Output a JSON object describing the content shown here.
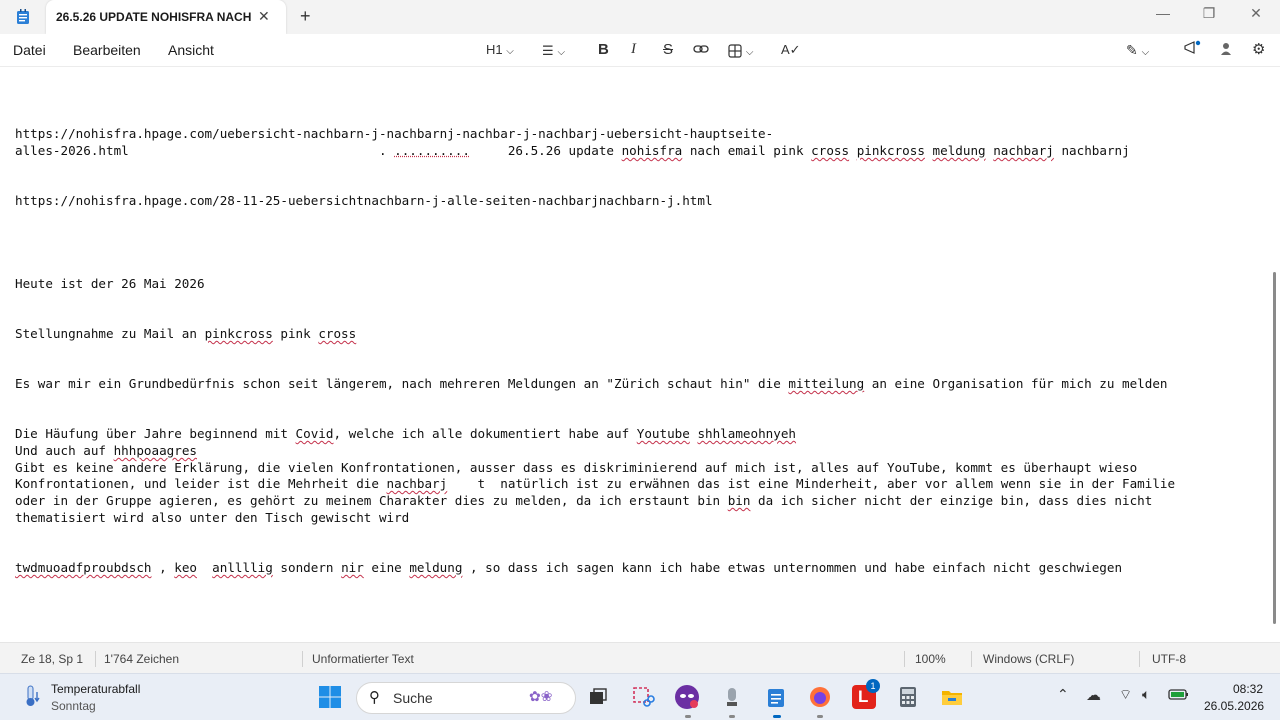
{
  "window": {
    "tab_title": "26.5.26 UPDATE NOHISFRA NACH",
    "tab_close": "✕",
    "new_tab": "+",
    "minimize": "—",
    "maximize": "❐",
    "close": "✕"
  },
  "menu": {
    "datei": "Datei",
    "bearbeiten": "Bearbeiten",
    "ansicht": "Ansicht"
  },
  "toolbar": {
    "heading": "H1",
    "bold": "B",
    "italic": "I",
    "strike": "S"
  },
  "document": {
    "line1": "https://nohisfra.hpage.com/uebersicht-nachbarn-j-nachbarnj-nachbar-j-nachbarj-uebersicht-hauptseite-",
    "line2_a": "alles-2026.html                                 . ",
    "line2_dots": "..........",
    "line2_b": "     26.5.26 update ",
    "line2_w1": "nohisfra",
    "line2_c": " nach email pink ",
    "line2_w2": "cross",
    "line2_d": " ",
    "line2_w3": "pinkcross",
    "line2_e": " ",
    "line2_w4": "meldung",
    "line2_f": " ",
    "line2_w5": "nachbarj",
    "line2_g": " nachbarnj",
    "line3": "https://nohisfra.hpage.com/28-11-25-uebersichtnachbarn-j-alle-seiten-nachbarjnachbarn-j.html",
    "line4": "Heute ist der 26 Mai 2026",
    "line5_a": "Stellungnahme zu Mail an ",
    "line5_w1": "pinkcross",
    "line5_b": " pink ",
    "line5_w2": "cross",
    "line6_a": "Es war mir ein Grundbedürfnis schon seit längerem, nach mehreren Meldungen an \"Zürich schaut hin\" die ",
    "line6_w1": "mitteilung",
    "line6_b": " an eine Organisation für mich zu melden",
    "line7_a": "Die Häufung über Jahre beginnend mit ",
    "line7_w1": "Covid",
    "line7_b": ", welche ich alle dokumentiert habe auf ",
    "line7_w2": "Youtube",
    "line7_c": " ",
    "line7_w3": "shhlameohnyeh",
    "line8_a": "Und auch auf ",
    "line8_w1": "hhhpoaagres",
    "line9": "Gibt es keine andere Erklärung, die vielen Konfrontationen, ausser dass es diskriminierend auf mich ist, alles auf YouTube, kommt es überhaupt wieso",
    "line10_a": "Konfrontationen, und leider ist die Mehrheit die ",
    "line10_w1": "nachbarj",
    "line10_b": "    t  natürlich ist zu erwähnen das ist eine Minderheit, aber vor allem wenn sie in der Familie",
    "line11_a": "oder in der Gruppe agieren, es gehört zu meinem Charakter dies zu melden, da ich erstaunt bin ",
    "line11_w1": "bin",
    "line11_b": " da ich sicher nicht der einzige bin, dass dies nicht",
    "line12": "thematisiert wird also unter den Tisch gewischt wird",
    "line13_w1": "twdmuoadfproubdsch",
    "line13_a": " , ",
    "line13_w2": "keo",
    "line13_b": "  ",
    "line13_w3": "anllllig",
    "line13_c": " sondern ",
    "line13_w4": "nir",
    "line13_d": " eine ",
    "line13_w5": "meldung",
    "line13_e": " , so dass ich sagen kann ich habe etwas unternommen und habe einfach nicht geschwiegen"
  },
  "status": {
    "position": "Ze 18, Sp 1",
    "chars": "1'764 Zeichen",
    "format": "Unformatierter Text",
    "zoom": "100%",
    "line_ending": "Windows (CRLF)",
    "encoding": "UTF-8"
  },
  "taskbar": {
    "weather_title": "Temperaturabfall",
    "weather_sub": "Sonntag",
    "search": "Suche",
    "badge": "1",
    "time": "08:32",
    "date": "26.05.2026"
  },
  "colors": {
    "spell_underline": "#c4314b",
    "accent": "#0067c0"
  }
}
